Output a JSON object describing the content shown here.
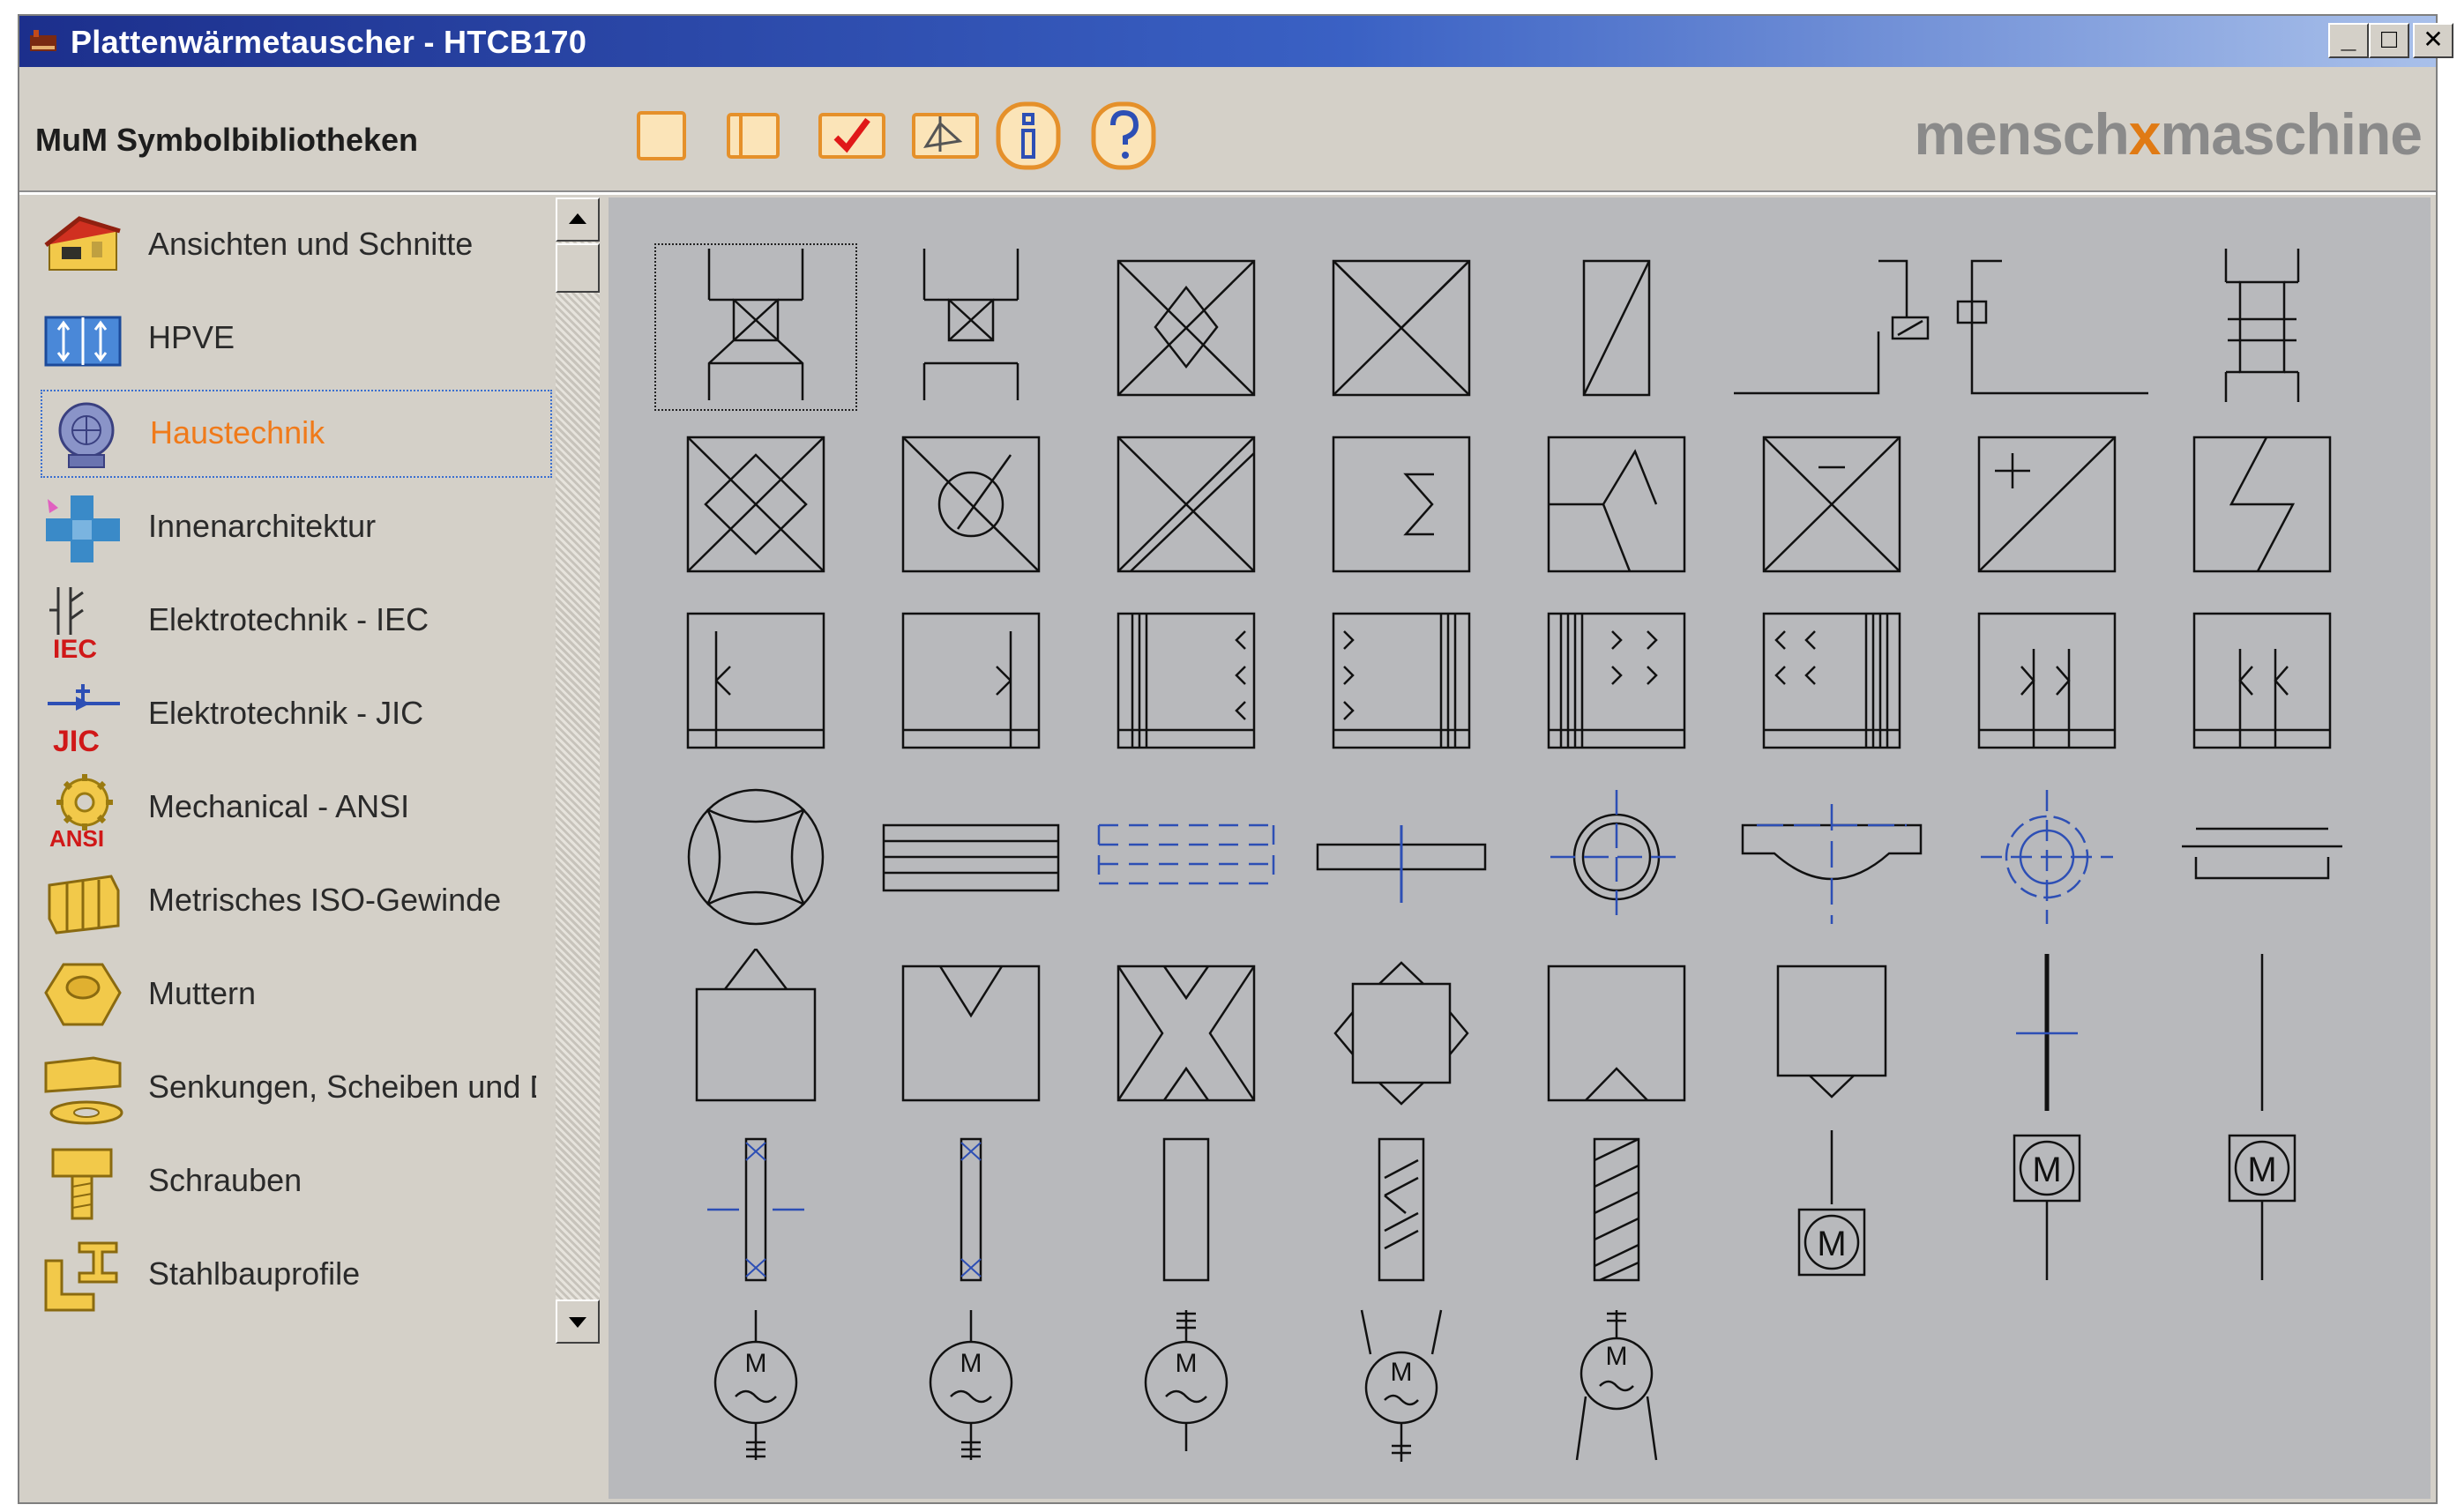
{
  "window": {
    "title": "Plattenwärmetauscher - HTCB170",
    "controls": [
      "_",
      "□",
      "✕"
    ]
  },
  "toolbar": {
    "library_label": "MuM Symbolbibliotheken",
    "tools": [
      {
        "icon": "new-page-icon"
      },
      {
        "icon": "open-book-icon"
      },
      {
        "icon": "checkmark-icon"
      },
      {
        "icon": "insert-icon"
      },
      {
        "icon": "info-icon"
      },
      {
        "icon": "help-icon"
      }
    ],
    "brand": {
      "left": "mensch",
      "middle": "x",
      "right": "maschine"
    }
  },
  "sidebar": {
    "items": [
      {
        "label": "Ansichten und Schnitte",
        "icon": "house-icon"
      },
      {
        "label": "HPVE",
        "icon": "hpve-icon"
      },
      {
        "label": "Haustechnik",
        "icon": "ventilator-icon",
        "selected": true
      },
      {
        "label": "Innenarchitektur",
        "icon": "furniture-icon"
      },
      {
        "label": "Elektrotechnik - IEC",
        "icon": "iec-icon",
        "badge": "IEC"
      },
      {
        "label": "Elektrotechnik - JIC",
        "icon": "jic-icon",
        "badge": "JIC"
      },
      {
        "label": "Mechanical - ANSI",
        "icon": "gear-icon",
        "badge": "ANSI"
      },
      {
        "label": "Metrisches ISO-Gewinde",
        "icon": "thread-icon"
      },
      {
        "label": "Muttern",
        "icon": "nut-icon"
      },
      {
        "label": "Senkungen, Scheiben und Du",
        "icon": "washer-icon"
      },
      {
        "label": "Schrauben",
        "icon": "screw-icon"
      },
      {
        "label": "Stahlbauprofile",
        "icon": "steel-profile-icon"
      }
    ]
  },
  "symbol_text": {
    "motor": "M"
  },
  "colors": {
    "accent": "#f07a1a",
    "title_start": "#1c2f8c",
    "symbol_stroke": "#111111",
    "symbol_blue": "#2d4fb5"
  }
}
